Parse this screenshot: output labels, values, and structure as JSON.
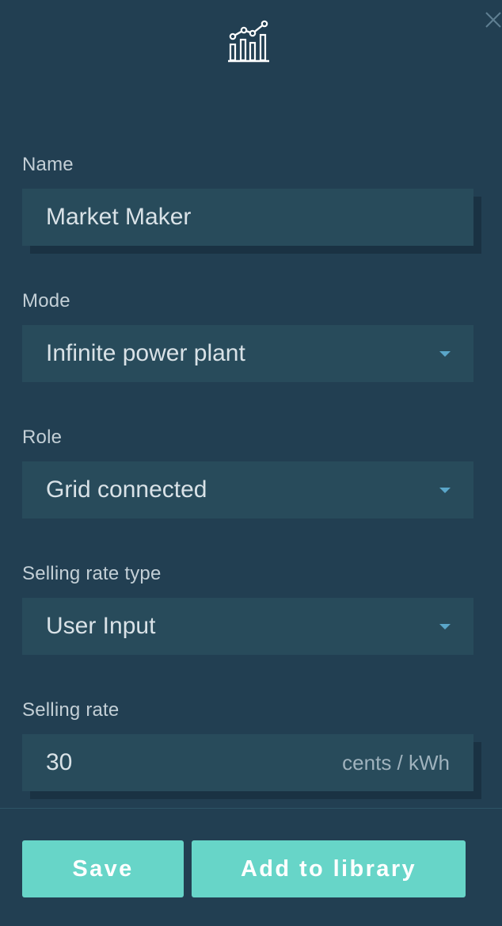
{
  "icons": {
    "header": "analytics-chart-icon",
    "close": "close-icon",
    "dropdown": "chevron-down-icon"
  },
  "colors": {
    "background": "#223f52",
    "field_background": "#284b5b",
    "accent_button": "#67d5c8",
    "dropdown_caret": "#5aa6c9"
  },
  "form": {
    "name": {
      "label": "Name",
      "value": "Market Maker"
    },
    "mode": {
      "label": "Mode",
      "value": "Infinite power plant"
    },
    "role": {
      "label": "Role",
      "value": "Grid connected"
    },
    "selling_rate_type": {
      "label": "Selling rate type",
      "value": "User Input"
    },
    "selling_rate": {
      "label": "Selling rate",
      "value": "30",
      "unit": "cents / kWh"
    }
  },
  "actions": {
    "save_label": "Save",
    "add_to_library_label": "Add to library"
  }
}
